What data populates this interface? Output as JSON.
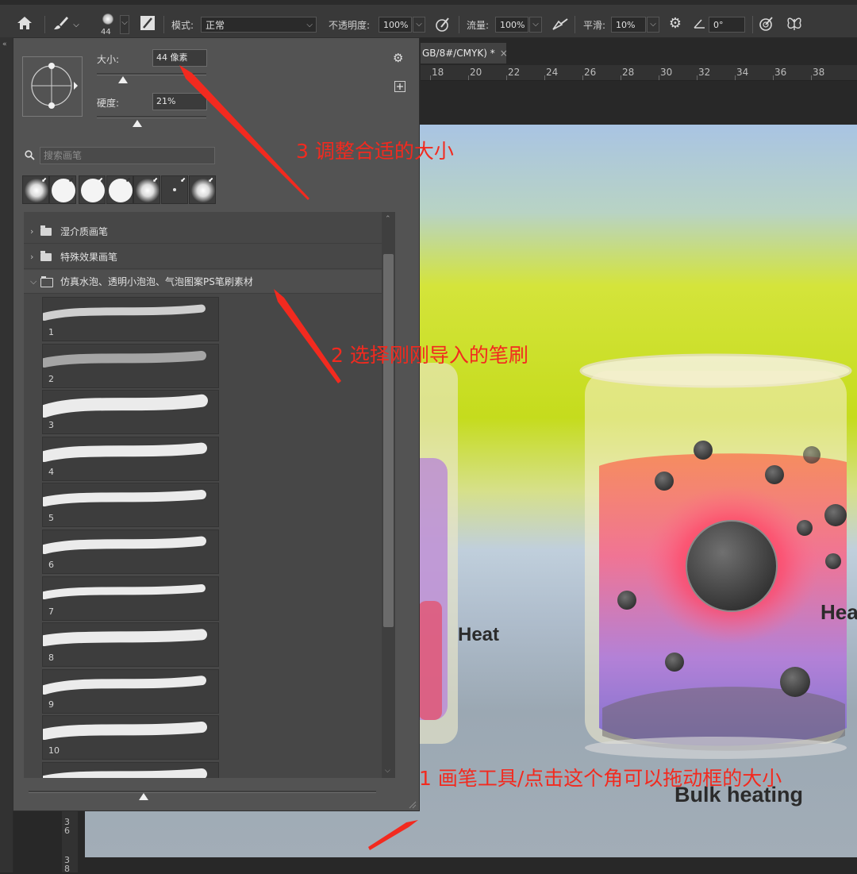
{
  "options_bar": {
    "brush_size_badge": "44",
    "mode_label": "模式:",
    "mode_value": "正常",
    "opacity_label": "不透明度:",
    "opacity_value": "100%",
    "flow_label": "流量:",
    "flow_value": "100%",
    "smoothing_label": "平滑:",
    "smoothing_value": "10%",
    "angle_value": "0°"
  },
  "document": {
    "tab_title": "GB/8#/CMYK) *",
    "close_glyph": "×",
    "ruler_ticks": [
      "18",
      "20",
      "22",
      "24",
      "26",
      "28",
      "30",
      "32",
      "34",
      "36",
      "38"
    ],
    "vruler_top": "3\n6",
    "vruler_bottom": "3\n8"
  },
  "brush_panel": {
    "size_label": "大小:",
    "size_value": "44 像素",
    "size_fraction": 0.08,
    "hardness_label": "硬度:",
    "hardness_value": "21%",
    "hardness_fraction": 0.21,
    "search_placeholder": "搜索画笔",
    "groups": [
      {
        "name": "湿介质画笔",
        "expanded": false
      },
      {
        "name": "特殊效果画笔",
        "expanded": false
      },
      {
        "name": "仿真水泡、透明小泡泡、气泡图案PS笔刷素材",
        "expanded": true
      }
    ],
    "brushes": [
      "1",
      "2",
      "3",
      "4",
      "5",
      "6",
      "7",
      "8",
      "9",
      "10",
      ""
    ]
  },
  "canvas": {
    "label_heat_left": "Heat",
    "label_heat_right": "Hea",
    "label_bulk": "Bulk heating"
  },
  "annotations": {
    "step3": "3 调整合适的大小",
    "step2": "2 选择刚刚导入的笔刷",
    "step1": "1 画笔工具/点击这个角可以拖动框的大小"
  },
  "colors": {
    "annotation_red": "#f22a1f",
    "panel_bg": "#535353",
    "options_bar_bg": "#393939"
  }
}
